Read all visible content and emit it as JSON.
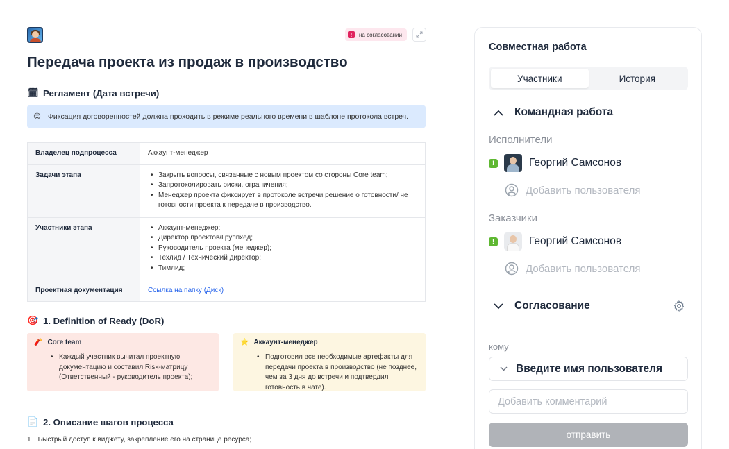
{
  "document": {
    "status_badge": "на согласовании",
    "title": "Передача проекта из продаж в производство",
    "reglament": {
      "emoji": "🗓",
      "heading": "Регламент (Дата встречи)"
    },
    "notice": {
      "emoji": "😊",
      "text": "Фиксация договоренностей должна проходить в режиме реального времени в шаблоне протокола встреч."
    },
    "table": {
      "owner_label": "Владелец подпроцесса",
      "owner_value": "Аккаунт-менеджер",
      "tasks_label": "Задачи этапа",
      "tasks": [
        "Закрыть вопросы, связанные с новым проектом со стороны Core team;",
        "Запротоколировать риски, ограничения;",
        "Менеджер проекта фиксирует в протоколе встречи решение о готовности/ не готовности проекта к передаче в производство."
      ],
      "participants_label": "Участники этапа",
      "participants": [
        "Аккаунт-менеджер;",
        "Директор проектов/Группхед;",
        "Руководитель проекта (менеджер);",
        "Техлид / Технический директор;",
        "Тимлид;"
      ],
      "docs_label": "Проектная документация",
      "docs_link": "Ссылка на папку (Диск)"
    },
    "dor": {
      "emoji": "🎯",
      "heading": "1. Definition of Ready (DoR)",
      "core_team": {
        "emoji": "🧨",
        "title": "Core team",
        "text": "Каждый участник  вычитал проектную документацию и составил Risk-матрицу (Ответственный - руководитель проекта);"
      },
      "account_manager": {
        "emoji": "⭐",
        "title": "Аккаунт-менеджер",
        "text": "Подготовил все необходимые артефакты для передачи проекта в производство (не позднее, чем за 3 дня до встречи и подтвердил готовность в чате)."
      }
    },
    "steps": {
      "emoji": "📄",
      "heading": "2. Описание шагов процесса",
      "items": [
        {
          "num": "1",
          "text": "Быстрый доступ к виджету, закрепление его на странице ресурса;"
        }
      ]
    }
  },
  "panel": {
    "title": "Совместная работа",
    "tabs": [
      {
        "label": "Участники",
        "active": true
      },
      {
        "label": "История",
        "active": false
      }
    ],
    "team_group": "Командная работа",
    "executors_label": "Исполнители",
    "executor": {
      "status": "!",
      "name": "Георгий Самсонов"
    },
    "customers_label": "Заказчики",
    "customer": {
      "status": "!",
      "name": "Георгий Самсонов"
    },
    "add_user": "Добавить пользователя",
    "approval_group": "Согласование",
    "to_label": "кому",
    "recipient_placeholder": "Введите имя пользователя",
    "comment_placeholder": "Добавить комментарий",
    "send_label": "отправить"
  },
  "colors": {
    "status_pink": "#e0245e",
    "status_green": "#5fb832",
    "notice_bg": "#dbeafe",
    "card_red_bg": "#fde8e4",
    "card_yellow_bg": "#fdf6e1",
    "link": "#2563eb",
    "button_disabled": "#b0b3b8"
  }
}
